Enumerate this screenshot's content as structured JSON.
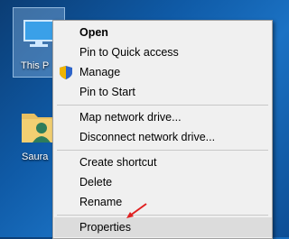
{
  "desktop": {
    "this_pc_label": "This P",
    "user_folder_label": "Saura"
  },
  "menu": {
    "open": "Open",
    "pin_quick_access": "Pin to Quick access",
    "manage": "Manage",
    "pin_start": "Pin to Start",
    "map_drive": "Map network drive...",
    "disconnect_drive": "Disconnect network drive...",
    "create_shortcut": "Create shortcut",
    "delete": "Delete",
    "rename": "Rename",
    "properties": "Properties"
  },
  "icons": {
    "this_pc": "computer-icon",
    "user_folder": "user-folder-icon",
    "manage": "uac-shield-icon",
    "annotation": "red-arrow"
  },
  "colors": {
    "desktop": "#0f5aa6",
    "menu_bg": "#f0f0f0",
    "hover": "#dcdcdc",
    "arrow": "#e02020"
  }
}
